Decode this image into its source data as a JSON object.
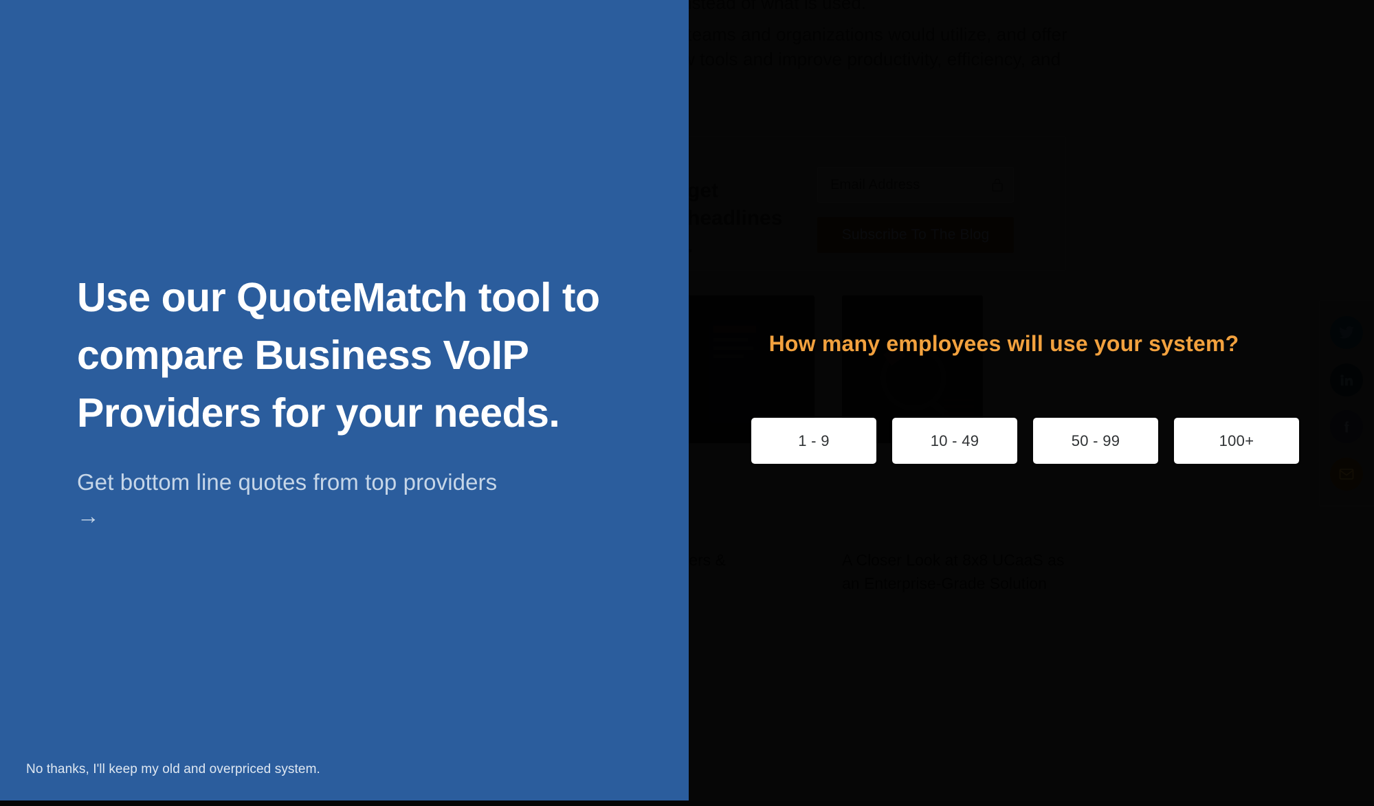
{
  "promo": {
    "headline": "Use our QuoteMatch tool to compare Business VoIP Providers for your needs.",
    "cta": "Get bottom line quotes from top providers →",
    "decline": "No thanks, I'll keep my old and overpriced system.",
    "bg_color": "#2b5d9d"
  },
  "modal": {
    "question": "How many employees will use your system?",
    "question_color": "#f2a13e",
    "options": [
      {
        "label": "1 - 9"
      },
      {
        "label": "10 - 49"
      },
      {
        "label": "50 - 99"
      },
      {
        "label": "100+"
      }
    ]
  },
  "background_page": {
    "paragraph_fragment_1": "nstead of what is used.",
    "paragraph_fragment_2": " teams and organizations would utilize, and offer\nw tools and improve productivity, efficiency, and",
    "subscribe": {
      "heading": "get\nheadlines\n.",
      "email_placeholder": "Email Address",
      "button_label": "Subscribe To The Blog",
      "lock_icon": "lock-icon"
    },
    "articles": [
      {
        "title": "oviders &"
      },
      {
        "title": "A Closer Look at 8x8 UCaaS as\nan Enterprise-Grade Solution"
      }
    ],
    "social": [
      {
        "name": "twitter-icon",
        "color": "#081925"
      },
      {
        "name": "linkedin-icon",
        "color": "#061018"
      },
      {
        "name": "facebook-icon",
        "color": "#14161f"
      },
      {
        "name": "email-icon",
        "color": "#2b1d06"
      }
    ]
  }
}
